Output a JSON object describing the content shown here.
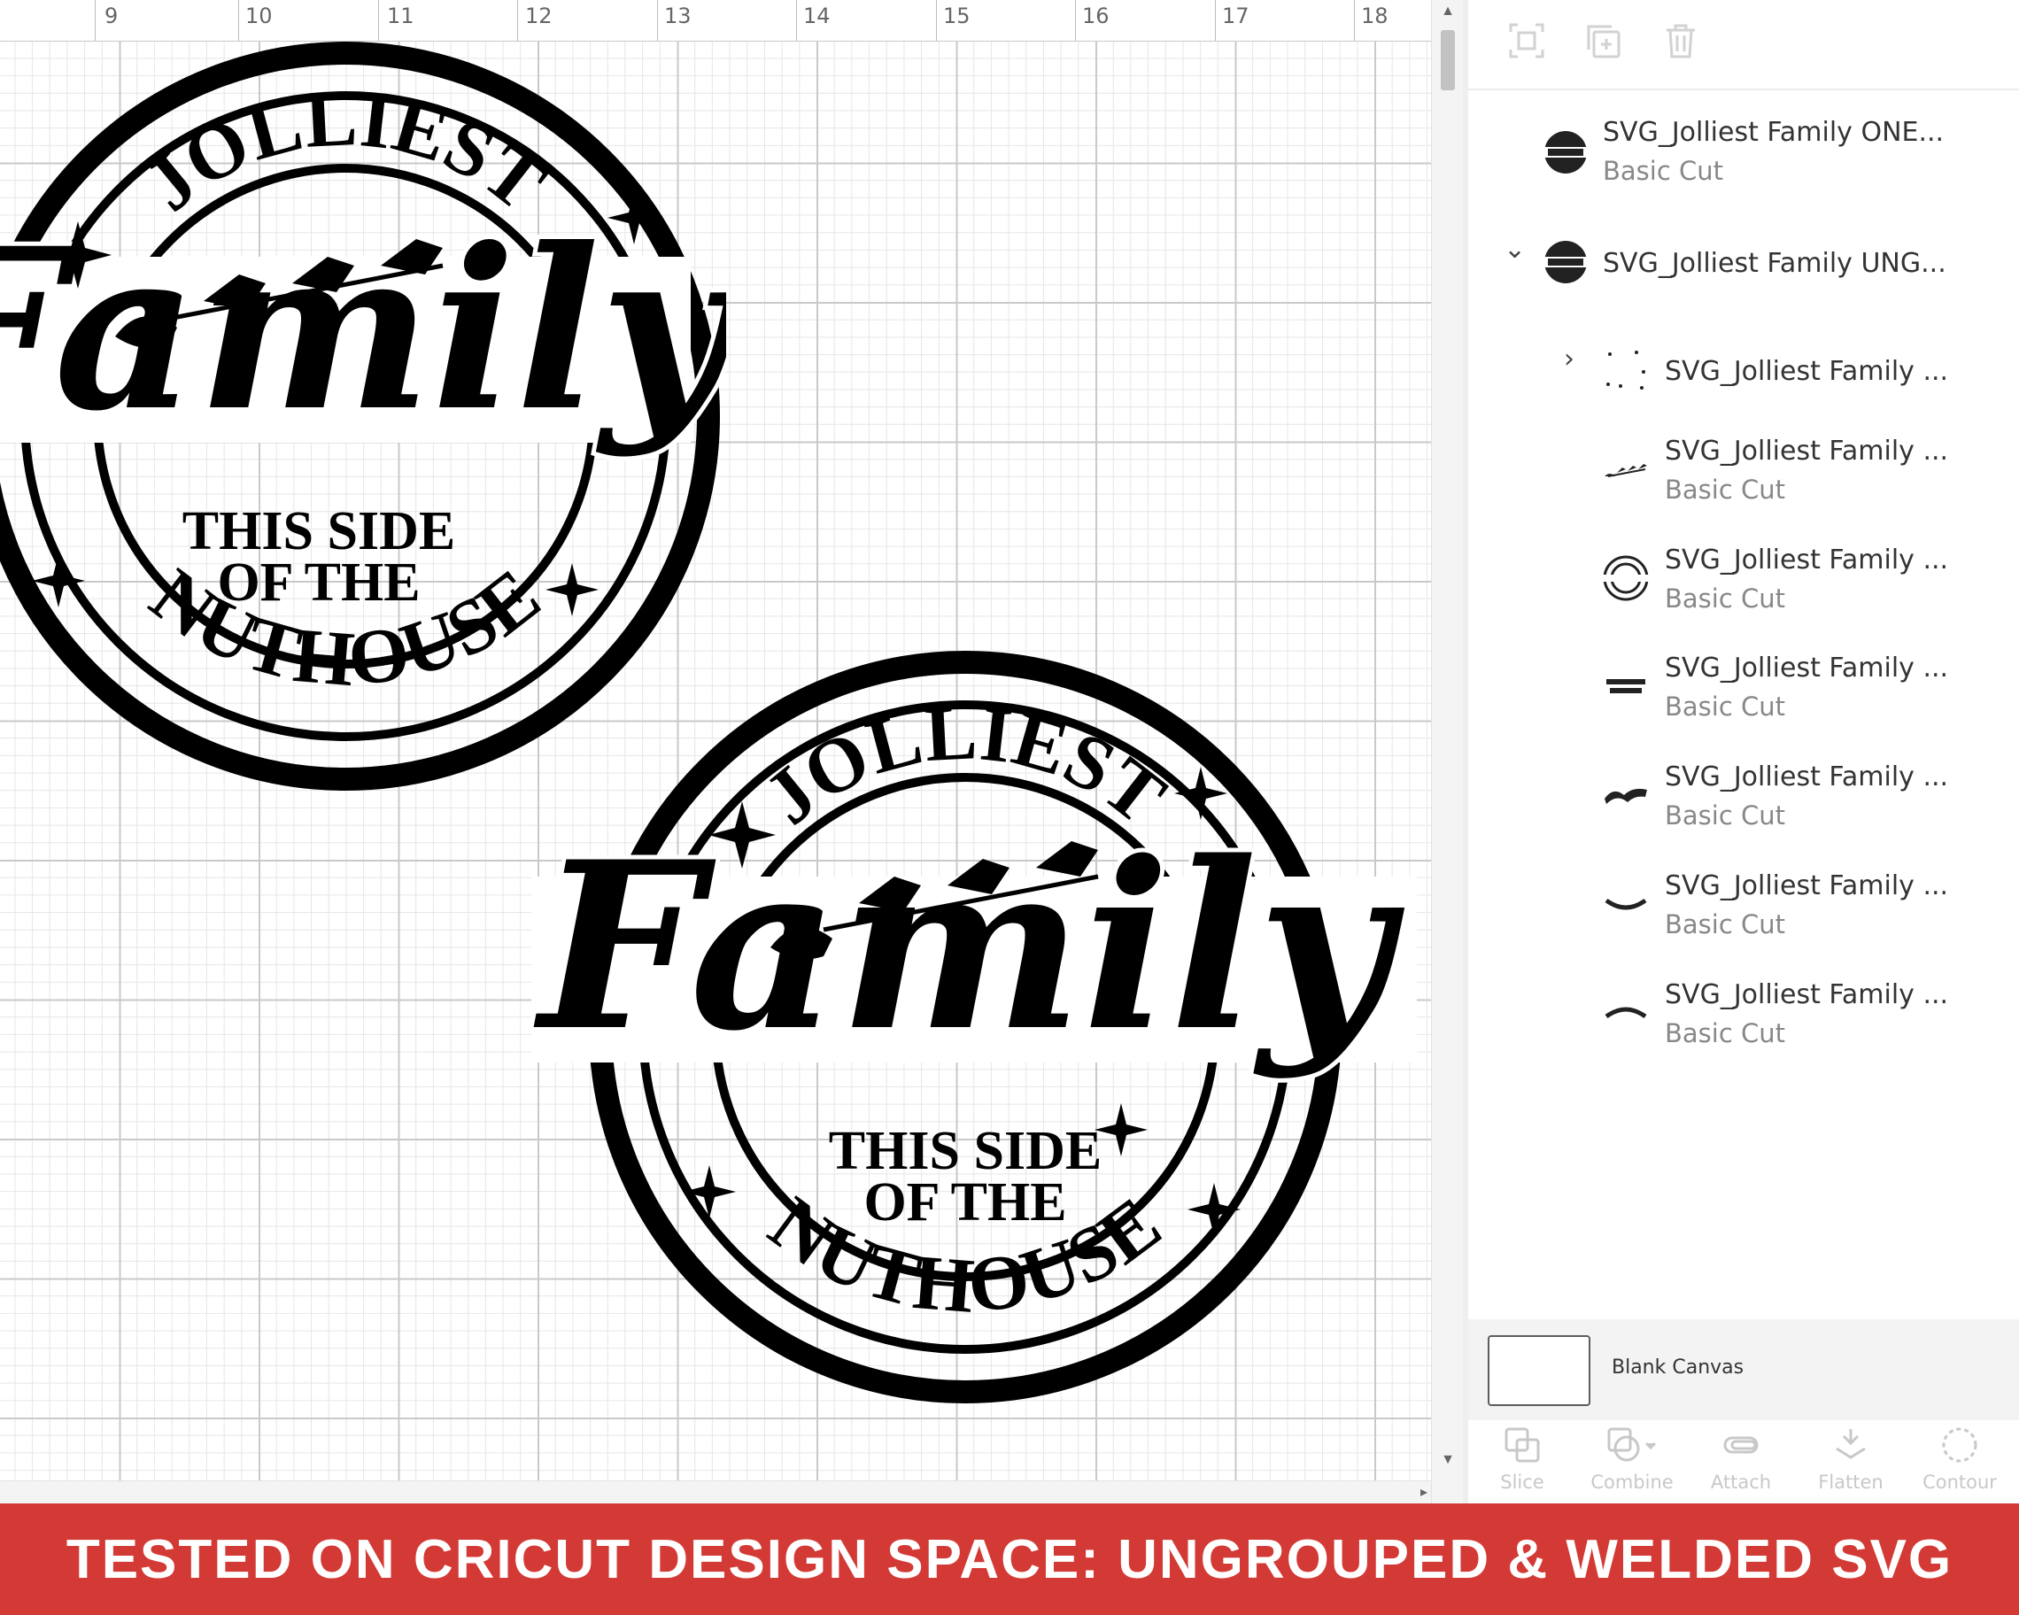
{
  "ruler": {
    "numbers": [
      "9",
      "10",
      "11",
      "12",
      "13",
      "14",
      "15",
      "16",
      "17",
      "18"
    ]
  },
  "design": {
    "word_top": "JOLLIEST",
    "word_script": "Family",
    "line1": "THIS SIDE",
    "line2": "OF THE",
    "word_bottom": "NUTHOUSE",
    "ink_color": "#000000"
  },
  "layers_panel": {
    "top_tools": [
      "group-icon",
      "duplicate-icon",
      "delete-icon"
    ],
    "layers": [
      {
        "name": "SVG_Jolliest Family ONE...",
        "sub": "Basic Cut",
        "thumb": "badge-thumb",
        "chevron": ""
      },
      {
        "name": "SVG_Jolliest Family UNG...",
        "sub": "",
        "thumb": "badge-thumb",
        "chevron": "⌄"
      },
      {
        "name": "SVG_Jolliest Family ...",
        "sub": "",
        "thumb": "stars-thumb",
        "chevron": "›"
      },
      {
        "name": "SVG_Jolliest Family ...",
        "sub": "Basic Cut",
        "thumb": "reindeer-thumb",
        "chevron": ""
      },
      {
        "name": "SVG_Jolliest Family ...",
        "sub": "Basic Cut",
        "thumb": "rings-thumb",
        "chevron": ""
      },
      {
        "name": "SVG_Jolliest Family ...",
        "sub": "Basic Cut",
        "thumb": "this-side-thumb",
        "chevron": ""
      },
      {
        "name": "SVG_Jolliest Family ...",
        "sub": "Basic Cut",
        "thumb": "family-thumb",
        "chevron": ""
      },
      {
        "name": "SVG_Jolliest Family ...",
        "sub": "Basic Cut",
        "thumb": "nuthouse-thumb",
        "chevron": ""
      },
      {
        "name": "SVG_Jolliest Family ...",
        "sub": "Basic Cut",
        "thumb": "jolliest-thumb",
        "chevron": ""
      }
    ],
    "canvas_label": "Blank Canvas",
    "bottom_tools": [
      "Slice",
      "Combine",
      "Attach",
      "Flatten",
      "Contour"
    ]
  },
  "banner": {
    "text": "TESTED ON CRICUT DESIGN SPACE: UNGROUPED & WELDED SVG",
    "color": "#d33a35"
  }
}
